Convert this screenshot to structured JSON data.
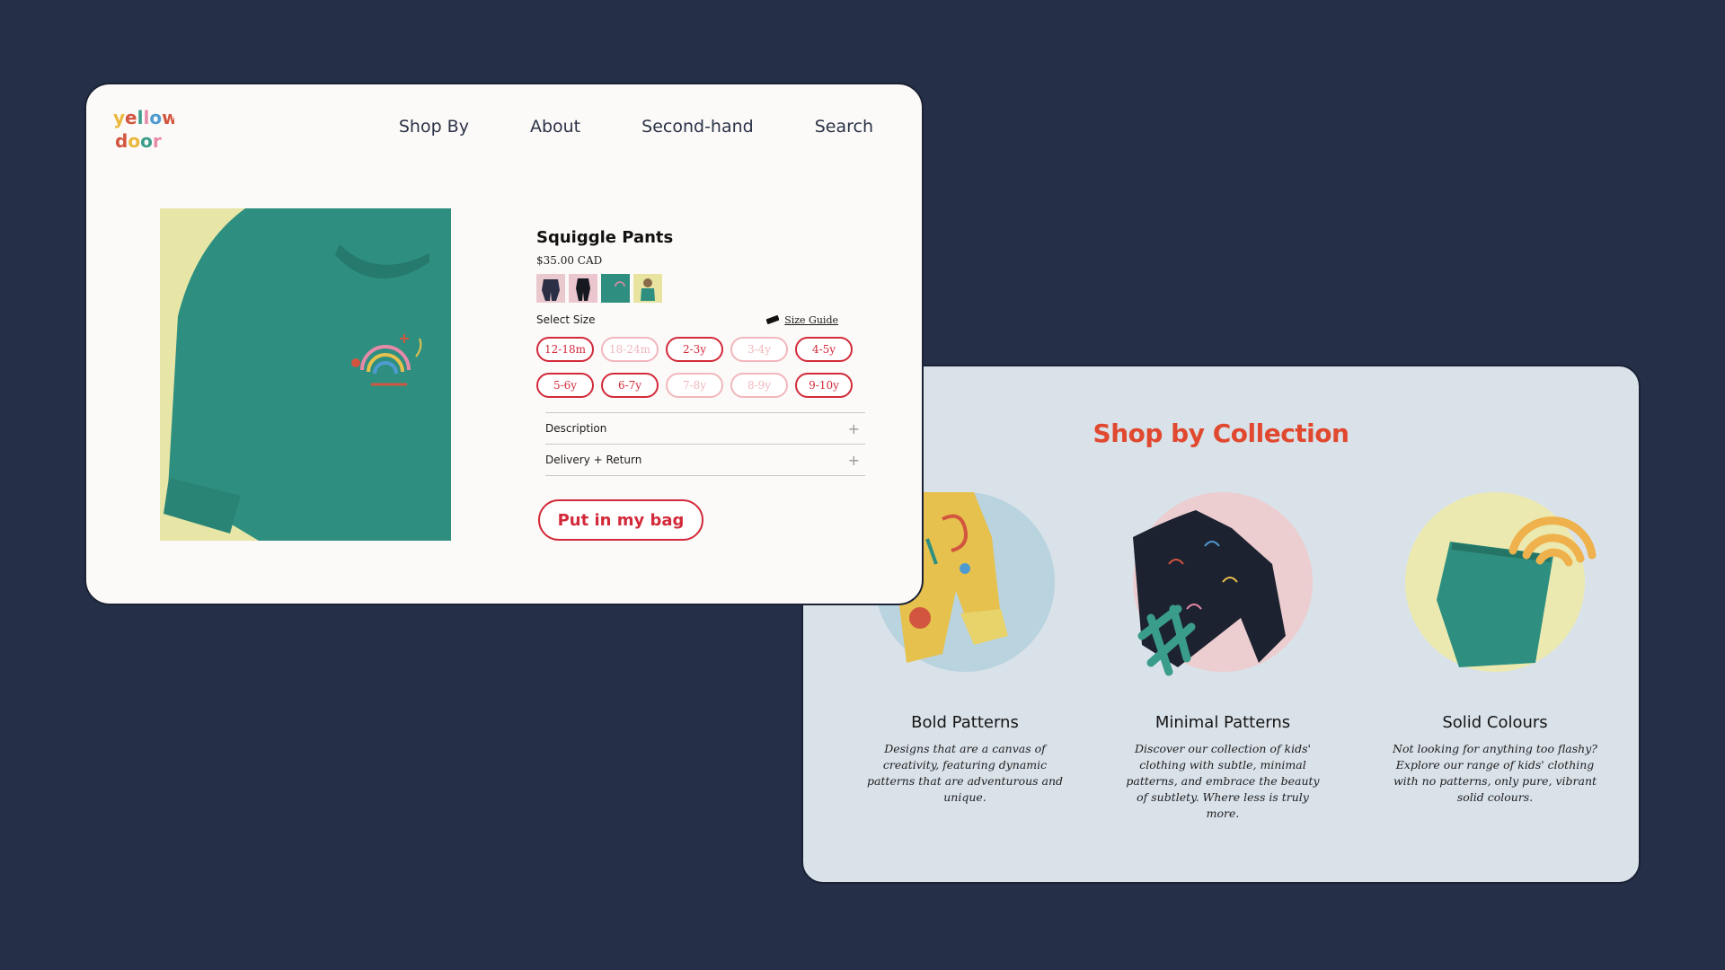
{
  "colors": {
    "background": "#252f47",
    "accent": "#d22a3a",
    "collection_title": "#e0492f",
    "product_image_bg": "#e8e6a6",
    "shirt": "#2e8f80"
  },
  "logo": {
    "icon": "yellow-door-logo",
    "text": "yellow door"
  },
  "nav": [
    {
      "label": "Shop By"
    },
    {
      "label": "About"
    },
    {
      "label": "Second-hand"
    },
    {
      "label": "Search"
    }
  ],
  "product": {
    "name": "Squiggle Pants",
    "price": "$35.00 CAD",
    "swatches": [
      {
        "icon": "navy-outfit-thumbnail"
      },
      {
        "icon": "black-outfit-thumbnail"
      },
      {
        "icon": "green-sweatshirt-thumbnail"
      },
      {
        "icon": "child-model-thumbnail"
      }
    ],
    "select_size_label": "Select Size",
    "size_guide_label": "Size Guide",
    "sizes": [
      {
        "label": "12-18m",
        "available": true
      },
      {
        "label": "18-24m",
        "available": false
      },
      {
        "label": "2-3y",
        "available": true
      },
      {
        "label": "3-4y",
        "available": false
      },
      {
        "label": "4-5y",
        "available": true
      },
      {
        "label": "5-6y",
        "available": true
      },
      {
        "label": "6-7y",
        "available": true
      },
      {
        "label": "7-8y",
        "available": false
      },
      {
        "label": "8-9y",
        "available": false
      },
      {
        "label": "9-10y",
        "available": true
      }
    ],
    "accordion": [
      {
        "label": "Description"
      },
      {
        "label": "Delivery + Return"
      }
    ],
    "add_to_bag_label": "Put in my bag"
  },
  "collection": {
    "title": "Shop by Collection",
    "items": [
      {
        "name": "Bold Patterns",
        "description": "Designs that are a canvas of creativity, featuring dynamic patterns that are adventurous and unique.",
        "circle_color": "#b9d3df"
      },
      {
        "name": "Minimal Patterns",
        "description": "Discover our collection of kids' clothing with subtle, minimal patterns, and embrace the beauty of subtlety. Where less is truly more.",
        "circle_color": "#eccdd0"
      },
      {
        "name": "Solid Colours",
        "description": "Not looking for anything too flashy? Explore our range of kids' clothing with no patterns, only pure, vibrant solid colours.",
        "circle_color": "#ece9b0"
      }
    ]
  }
}
